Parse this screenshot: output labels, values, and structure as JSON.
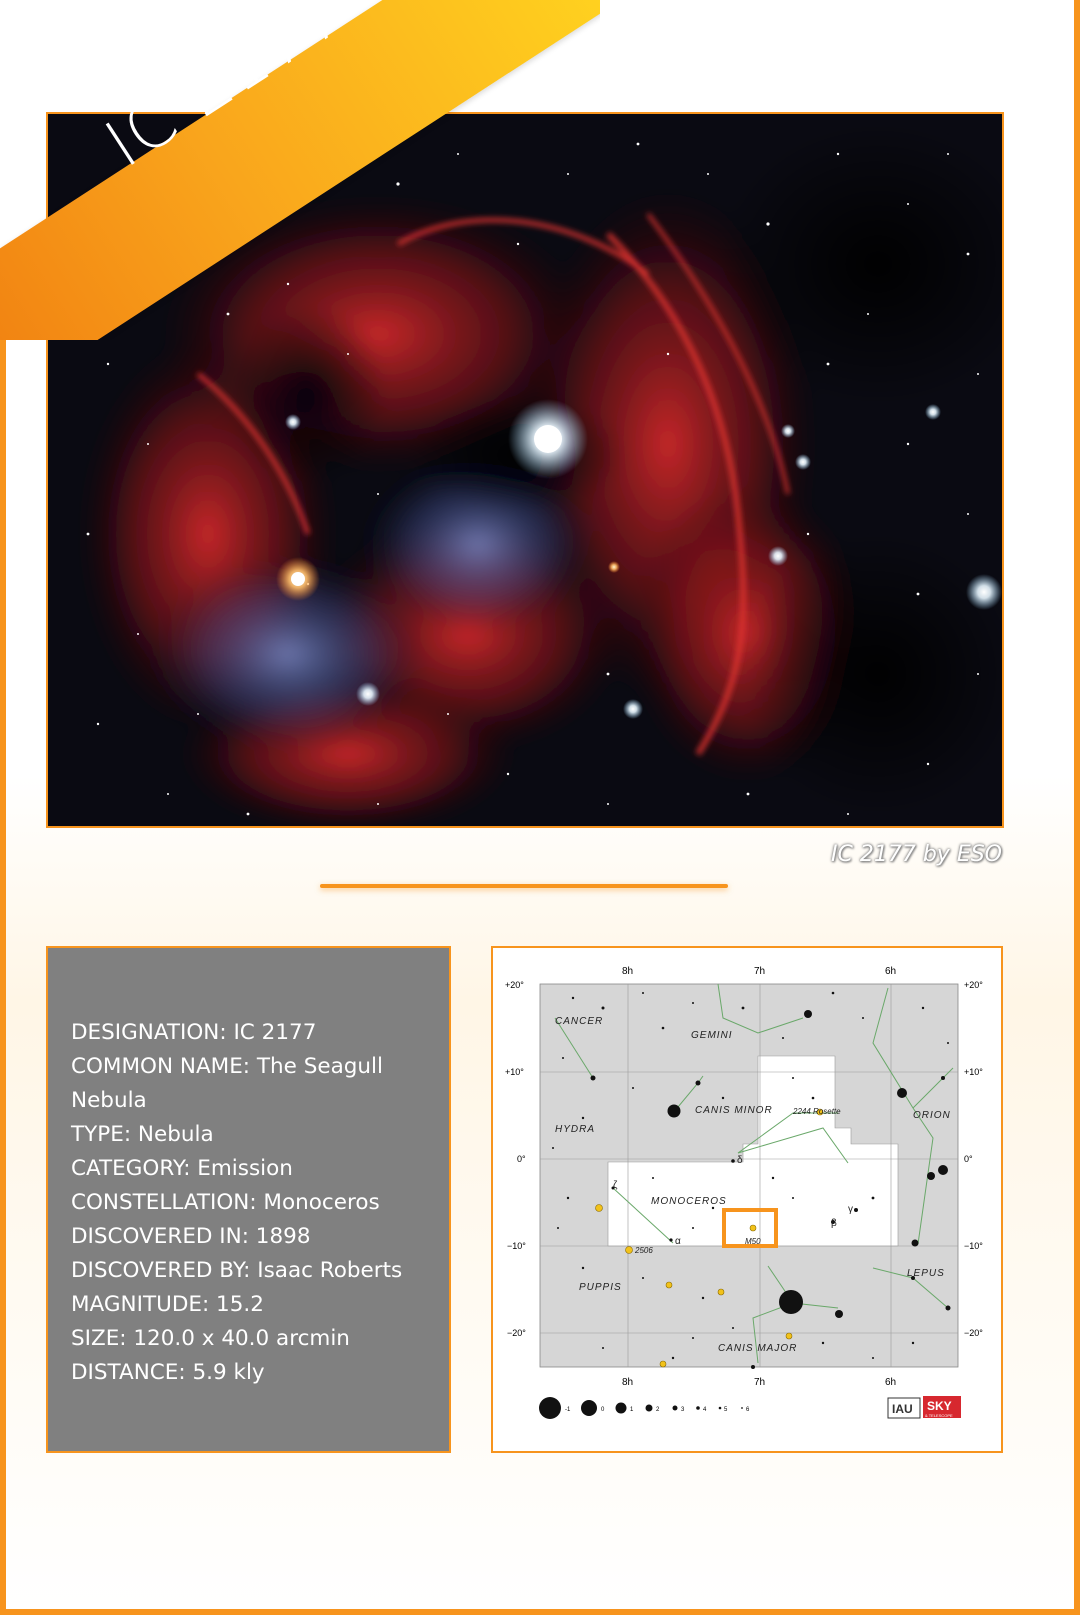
{
  "banner": {
    "title": "IC 2177"
  },
  "photo": {
    "credit": "IC 2177 by ESO"
  },
  "info": {
    "lines": [
      "DESIGNATION: IC 2177",
      "COMMON NAME: The Seagull",
      "Nebula",
      "TYPE: Nebula",
      "CATEGORY: Emission",
      "CONSTELLATION: Monoceros",
      "DISCOVERED IN: 1898",
      "DISCOVERED BY: Isaac Roberts",
      "MAGNITUDE: 15.2",
      "SIZE: 120.0 x 40.0 arcmin",
      "DISTANCE: 5.9 kly"
    ]
  },
  "star_chart": {
    "ra_top": [
      "8h",
      "7h",
      "6h"
    ],
    "ra_bottom": [
      "8h",
      "7h",
      "6h"
    ],
    "dec": [
      "+20°",
      "+10°",
      "0°",
      "−10°",
      "−20°"
    ],
    "constellations": [
      "CANCER",
      "GEMINI",
      "HYDRA",
      "CANIS MINOR",
      "ORION",
      "MONOCEROS",
      "PUPPIS",
      "LEPUS",
      "CANIS MAJOR"
    ],
    "objects": [
      "2244 Rosette",
      "M50",
      "2506"
    ],
    "greek": [
      "δ",
      "ζ",
      "α",
      "β",
      "γ"
    ],
    "magnitude_scale": [
      "-1",
      "0",
      "1",
      "2",
      "3",
      "4",
      "5",
      "6"
    ],
    "logos": [
      "IAU",
      "SKY",
      "& TELESCOPE"
    ],
    "colors": {
      "highlight": "#f7941d",
      "region": "#ffffff",
      "background": "#d8d8d8",
      "lines": "#6aa86a"
    }
  },
  "colors": {
    "accent": "#f7941d",
    "panel": "#808080"
  }
}
